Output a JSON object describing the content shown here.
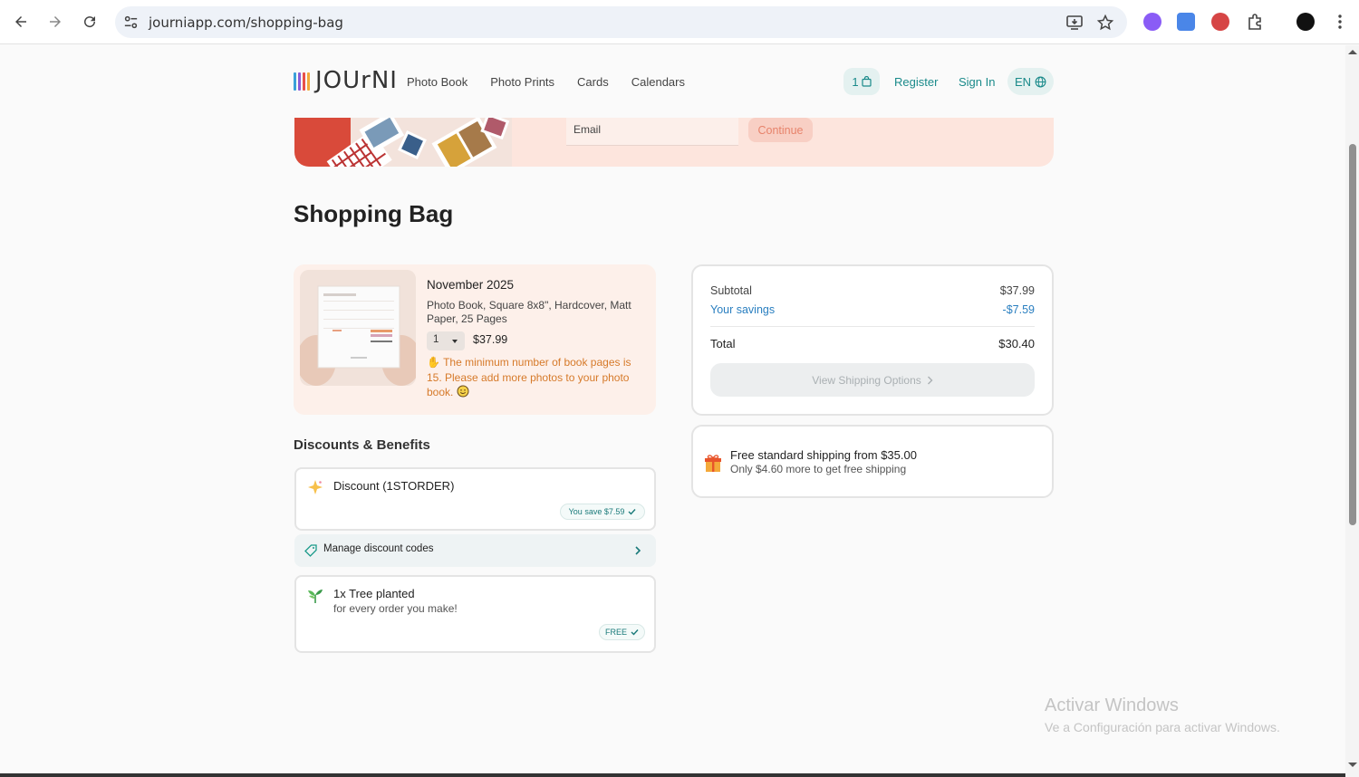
{
  "browser": {
    "url": "journiapp.com/shopping-bag",
    "icons": [
      "back-icon",
      "forward-icon",
      "reload-icon",
      "site-settings-icon",
      "install-icon",
      "bookmark-star-icon",
      "extension-icon",
      "translate-icon",
      "shield-extension-icon",
      "puzzle-icon",
      "profile-avatar",
      "menu-dots-icon"
    ]
  },
  "header": {
    "logo_text": "JOUrNI",
    "nav": [
      "Photo Book",
      "Photo Prints",
      "Cards",
      "Calendars"
    ],
    "bag_count": "1",
    "register": "Register",
    "sign_in": "Sign In",
    "language": "EN"
  },
  "promo": {
    "email_placeholder": "Email",
    "continue_label": "Continue"
  },
  "page_title": "Shopping Bag",
  "product": {
    "title": "November 2025",
    "description": "Photo Book, Square 8x8\", Hardcover, Matt Paper, 25 Pages",
    "quantity": "1",
    "price": "$37.99",
    "warning": "The minimum number of book pages is 15. Please add more photos to your photo book."
  },
  "discounts": {
    "section_title": "Discounts & Benefits",
    "discount_label": "Discount (1STORDER)",
    "discount_badge": "You save $7.59",
    "manage_label": "Manage discount codes",
    "tree_title": "1x Tree planted",
    "tree_sub": "for every order you make!",
    "tree_badge": "FREE"
  },
  "summary": {
    "subtotal_label": "Subtotal",
    "subtotal_value": "$37.99",
    "savings_label": "Your savings",
    "savings_value": "-$7.59",
    "total_label": "Total",
    "total_value": "$30.40",
    "shipping_button": "View Shipping Options",
    "free_ship_title": "Free standard shipping from $35.00",
    "free_ship_sub": "Only $4.60 more to get free shipping"
  },
  "watermark": {
    "title": "Activar Windows",
    "subtitle": "Ve a Configuración para activar Windows."
  },
  "colors": {
    "accent": "#1a8a8a",
    "savings": "#2a7fc0",
    "warning": "#d67a2a",
    "promo_bg": "#fde5dd"
  }
}
